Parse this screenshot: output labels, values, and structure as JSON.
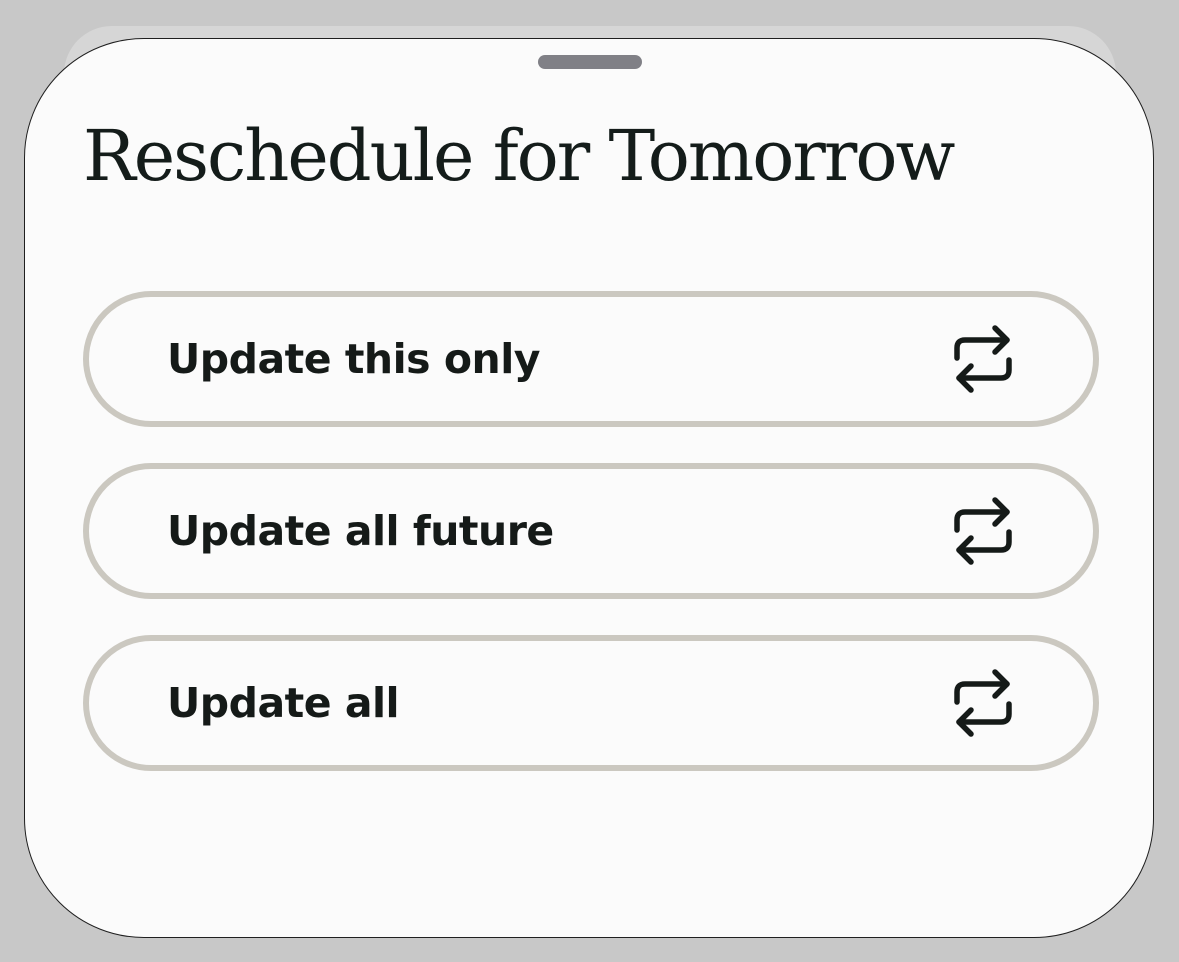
{
  "sheet": {
    "title": "Reschedule for Tomorrow",
    "options": [
      {
        "label": "Update this only",
        "icon": "repeat-icon"
      },
      {
        "label": "Update all future",
        "icon": "repeat-icon"
      },
      {
        "label": "Update all",
        "icon": "repeat-icon"
      }
    ]
  },
  "colors": {
    "background": "#c8c8c8",
    "sheet": "#fbfbfb",
    "grabber": "#808086",
    "option_border": "#cbc8c0",
    "text": "#151a18"
  }
}
